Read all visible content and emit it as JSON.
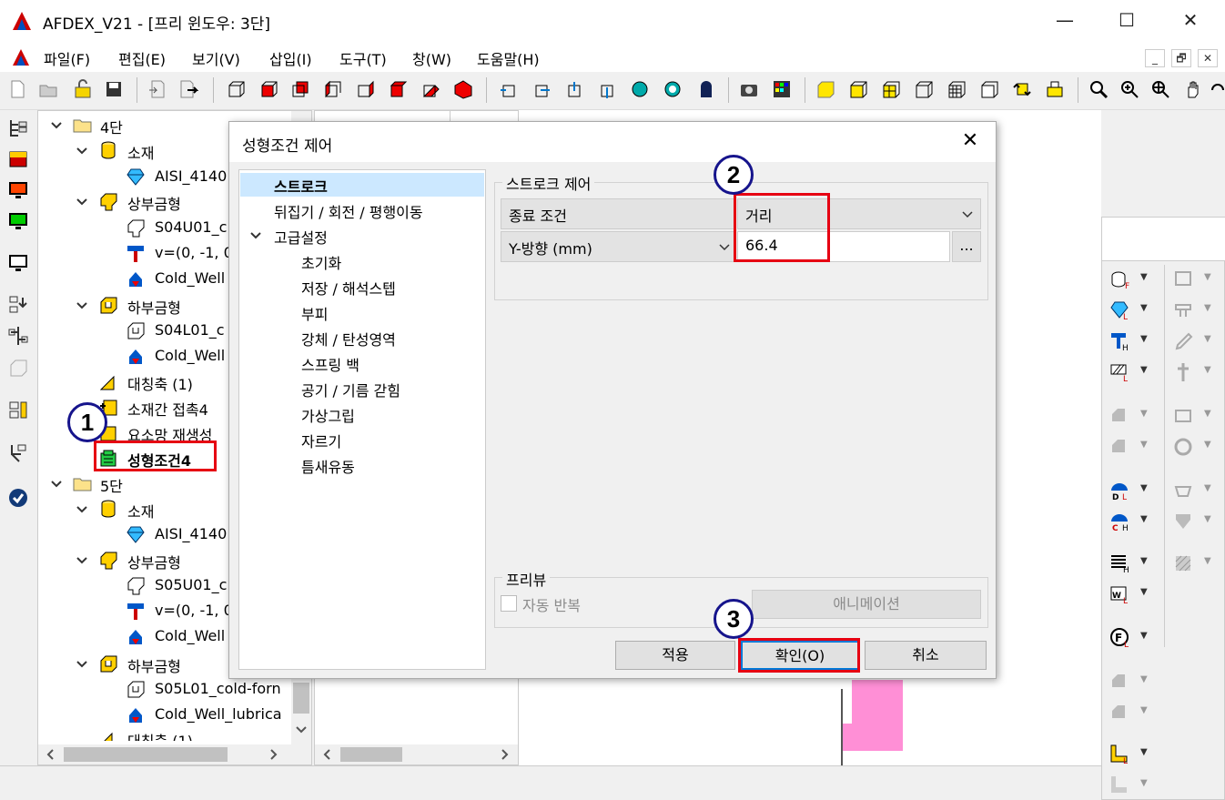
{
  "window": {
    "title": "AFDEX_V21 - [프리 윈도우: 3단]",
    "minimize": "—",
    "maximize": "☐",
    "close": "✕"
  },
  "menu": [
    "파일(F)",
    "편집(E)",
    "보기(V)",
    "삽입(I)",
    "도구(T)",
    "창(W)",
    "도움말(H)"
  ],
  "mdi": {
    "min": "_",
    "restore": "🗗",
    "close": "✕"
  },
  "tree": {
    "stage4": "4단",
    "material": "소재",
    "material_item": "AISI_4140",
    "upper_die": "상부금형",
    "upper_item1": "S04U01_c",
    "upper_item2": "v=(0, -1, 0",
    "upper_item3": "Cold_Well",
    "lower_die": "하부금형",
    "lower_item1": "S04L01_c",
    "lower_item2": "Cold_Well",
    "symmetry": "대칭축 (1)",
    "contact": "소재간 접촉4",
    "remesh": "요소망 재생성",
    "forming": "성형조건4",
    "stage5": "5단",
    "material5": "소재",
    "material5_item": "AISI_4140",
    "upper_die5": "상부금형",
    "upper5_item1": "S05U01_c",
    "upper5_item2": "v=(0, -1, 0",
    "upper5_item3": "Cold_Well",
    "lower_die5": "하부금형",
    "lower5_item1": "S05L01_cold-forn",
    "lower5_item2": "Cold_Well_lubrica",
    "symmetry5": "대칭축 (1)"
  },
  "dialog": {
    "title": "성형조건 제어",
    "nav": [
      "스트로크",
      "뒤집기 / 회전 / 평행이동",
      "고급설정",
      "초기화",
      "저장 / 해석스텝",
      "부피",
      "강체 / 탄성영역",
      "스프링 백",
      "공기 / 기름 갇힘",
      "가상그립",
      "자르기",
      "틈새유동"
    ],
    "stroke_group": "스트로크 제어",
    "end_condition_label": "종료 조건",
    "end_condition_value": "거리",
    "direction_value": "Y-방향 (mm)",
    "distance_value": "66.4",
    "ellipsis": "...",
    "preview_group": "프리뷰",
    "auto_repeat": "자동 반복",
    "animation": "애니메이션",
    "apply": "적용",
    "ok": "확인(O)",
    "cancel": "취소"
  },
  "callouts": [
    "1",
    "2",
    "3"
  ],
  "colors": {
    "highlight_red": "#e60012",
    "callout_blue": "#16148c",
    "selection": "#cce8ff",
    "part_pink": "#ff8fd6"
  }
}
